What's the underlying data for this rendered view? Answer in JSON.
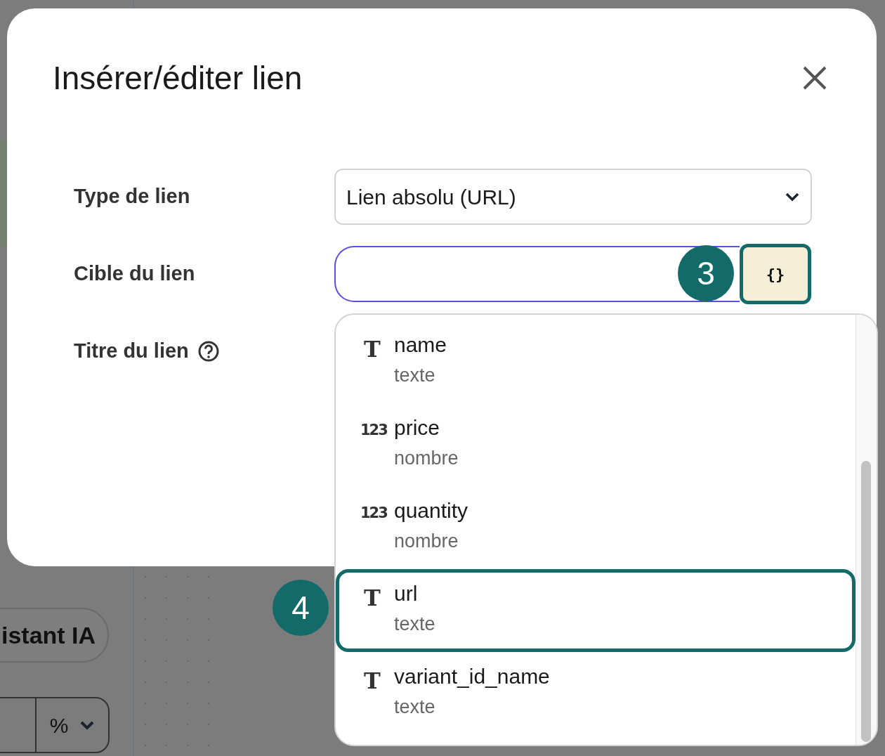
{
  "background": {
    "assistant_button": "istant IA",
    "unit_select": "%"
  },
  "dialog": {
    "title": "Insérer/éditer lien",
    "fields": [
      {
        "label": "Type de lien",
        "kind": "select",
        "value": "Lien absolu (URL)",
        "help": false
      },
      {
        "label": "Cible du lien",
        "kind": "input",
        "focused": true,
        "help": false
      },
      {
        "label": "Titre du lien",
        "kind": "empty",
        "help": true
      }
    ],
    "variable_button": "{}"
  },
  "callouts": [
    "3",
    "4"
  ],
  "dropdown": {
    "items": [
      {
        "icon": "T",
        "name": "name",
        "type": "texte",
        "selected": false
      },
      {
        "icon": "123",
        "name": "price",
        "type": "nombre",
        "selected": false
      },
      {
        "icon": "123",
        "name": "quantity",
        "type": "nombre",
        "selected": false
      },
      {
        "icon": "T",
        "name": "url",
        "type": "texte",
        "selected": true
      },
      {
        "icon": "T",
        "name": "variant_id_name",
        "type": "texte",
        "selected": false
      }
    ]
  }
}
